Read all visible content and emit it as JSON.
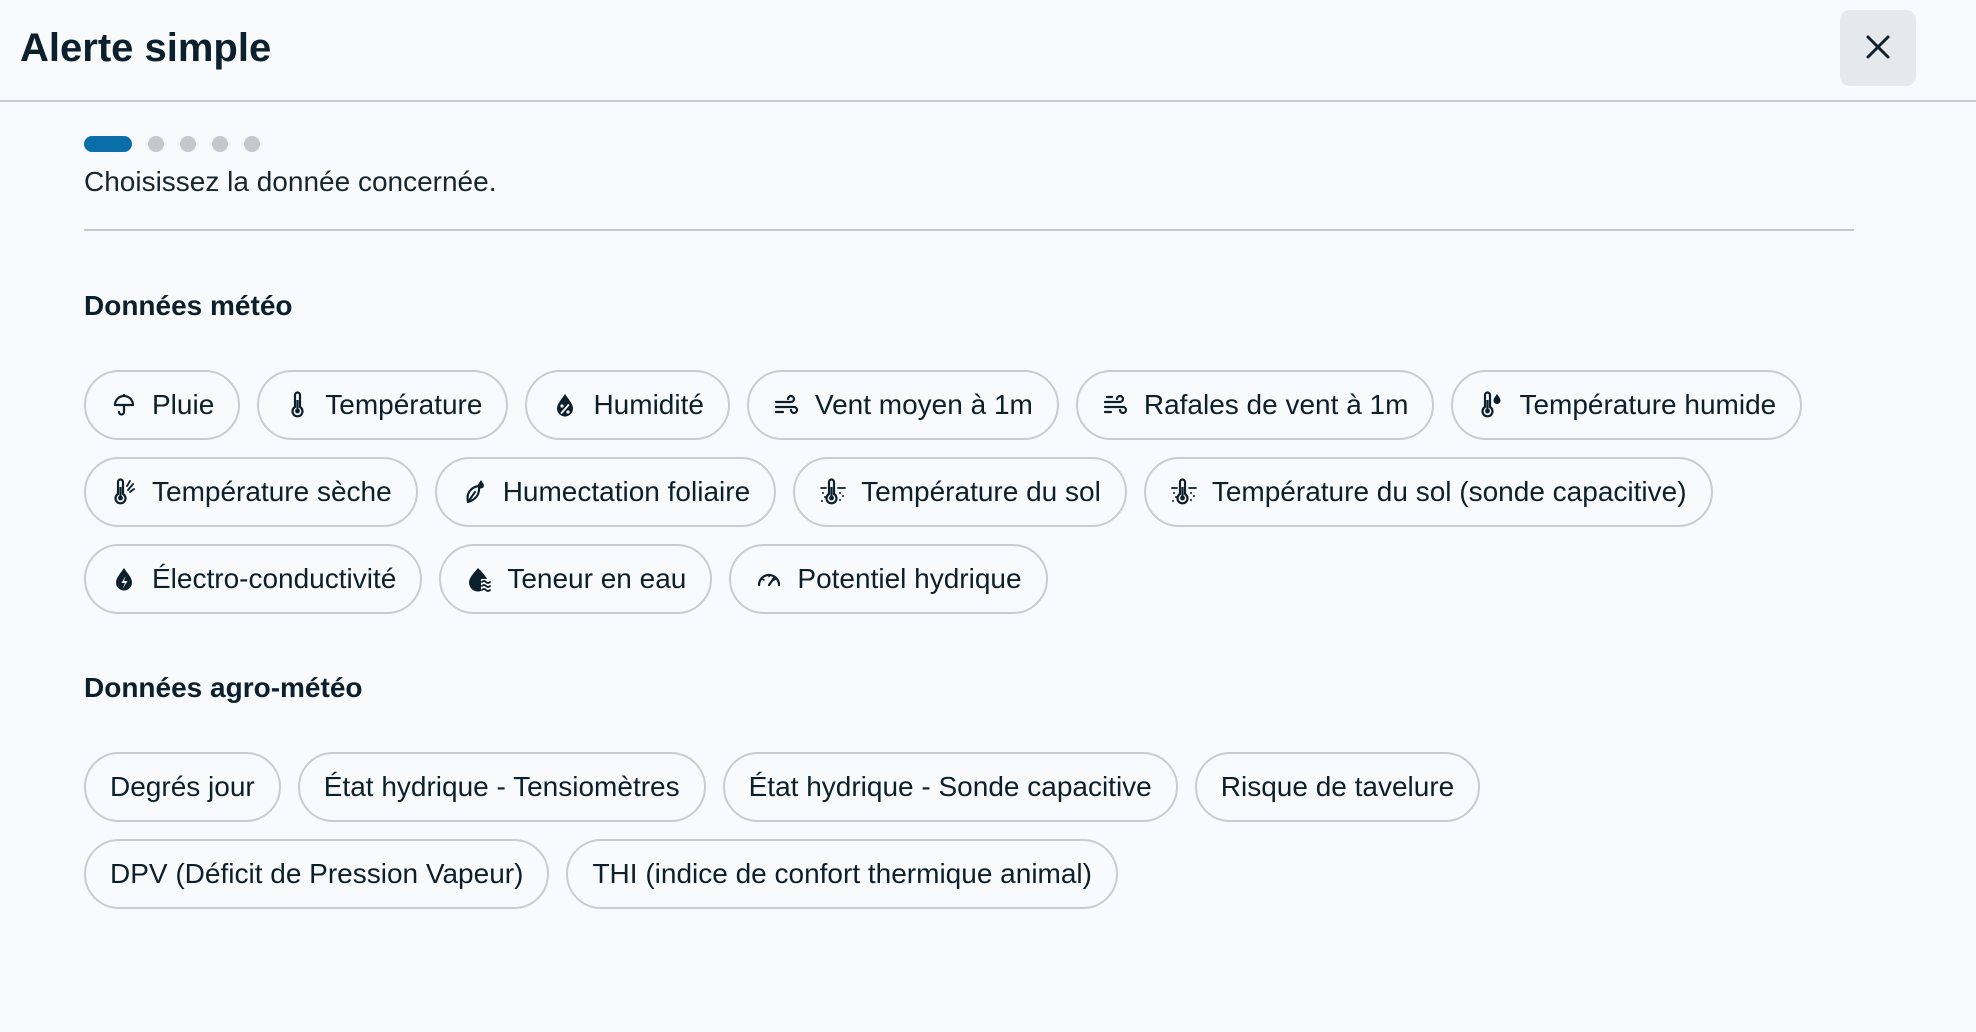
{
  "header": {
    "title": "Alerte simple",
    "close_icon": "close-icon"
  },
  "stepper": {
    "total_steps": 5,
    "current_step": 1,
    "active_color": "#0a6fa8",
    "inactive_color": "#c4c8cd"
  },
  "instruction": "Choisissez la donnée concernée.",
  "sections": [
    {
      "title": "Données météo",
      "chips": [
        {
          "label": "Pluie",
          "icon": "umbrella-icon"
        },
        {
          "label": "Température",
          "icon": "thermometer-icon"
        },
        {
          "label": "Humidité",
          "icon": "humidity-drop-icon"
        },
        {
          "label": "Vent moyen à 1m",
          "icon": "wind-icon"
        },
        {
          "label": "Rafales de vent à 1m",
          "icon": "wind-gust-icon"
        },
        {
          "label": "Température humide",
          "icon": "thermometer-drop-icon"
        },
        {
          "label": "Température sèche",
          "icon": "thermometer-dry-icon"
        },
        {
          "label": "Humectation foliaire",
          "icon": "leaf-drop-icon"
        },
        {
          "label": "Température du sol",
          "icon": "soil-thermometer-icon"
        },
        {
          "label": "Température du sol (sonde capacitive)",
          "icon": "soil-thermometer-icon"
        },
        {
          "label": "Électro-conductivité",
          "icon": "conductivity-drop-icon"
        },
        {
          "label": "Teneur en eau",
          "icon": "water-content-icon"
        },
        {
          "label": "Potentiel hydrique",
          "icon": "gauge-icon"
        }
      ]
    },
    {
      "title": "Données agro-météo",
      "chips": [
        {
          "label": "Degrés jour",
          "icon": ""
        },
        {
          "label": "État hydrique - Tensiomètres",
          "icon": ""
        },
        {
          "label": "État hydrique - Sonde capacitive",
          "icon": ""
        },
        {
          "label": "Risque de tavelure",
          "icon": ""
        },
        {
          "label": "DPV (Déficit de Pression Vapeur)",
          "icon": ""
        },
        {
          "label": "THI (indice de confort thermique animal)",
          "icon": ""
        }
      ]
    }
  ]
}
